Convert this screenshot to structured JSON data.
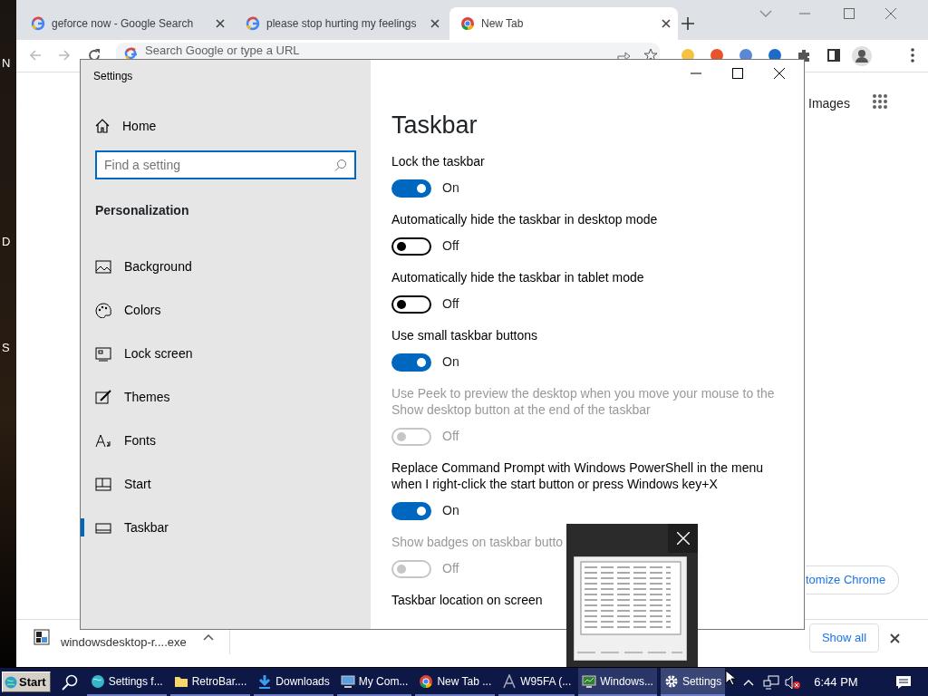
{
  "desktop": {
    "icon_labels": [
      "N",
      "D",
      "S"
    ]
  },
  "browser": {
    "tabs": [
      {
        "title": "geforce now - Google Search",
        "selected": false
      },
      {
        "title": "please stop hurting my feelings",
        "selected": false
      },
      {
        "title": "New Tab",
        "selected": true
      }
    ],
    "omnibox": {
      "placeholder": "Search Google or type a URL"
    },
    "content": {
      "images_link": "Images",
      "customize_button": "tomize Chrome"
    },
    "download_bar": {
      "file": "windowsdesktop-r....exe",
      "show_all": "Show all"
    }
  },
  "settings": {
    "title": "Settings",
    "home": "Home",
    "search": {
      "placeholder": "Find a setting"
    },
    "section": "Personalization",
    "nav": [
      {
        "label": "Background",
        "selected": false
      },
      {
        "label": "Colors",
        "selected": false
      },
      {
        "label": "Lock screen",
        "selected": false
      },
      {
        "label": "Themes",
        "selected": false
      },
      {
        "label": "Fonts",
        "selected": false
      },
      {
        "label": "Start",
        "selected": false
      },
      {
        "label": "Taskbar",
        "selected": true
      }
    ],
    "heading": "Taskbar",
    "options": [
      {
        "label": "Lock the taskbar",
        "on": true,
        "disabled": false,
        "state_text": "On"
      },
      {
        "label": "Automatically hide the taskbar in desktop mode",
        "on": false,
        "disabled": false,
        "state_text": "Off"
      },
      {
        "label": "Automatically hide the taskbar in tablet mode",
        "on": false,
        "disabled": false,
        "state_text": "Off"
      },
      {
        "label": "Use small taskbar buttons",
        "on": true,
        "disabled": false,
        "state_text": "On"
      },
      {
        "label": "Use Peek to preview the desktop when you move your mouse to the Show desktop button at the end of the taskbar",
        "on": false,
        "disabled": true,
        "state_text": "Off"
      },
      {
        "label": "Replace Command Prompt with Windows PowerShell in the menu when I right-click the start button or press Windows key+X",
        "on": true,
        "disabled": false,
        "state_text": "On"
      },
      {
        "label": "Show badges on taskbar butto",
        "on": false,
        "disabled": true,
        "state_text": "Off"
      }
    ],
    "location_label": "Taskbar location on screen"
  },
  "taskbar": {
    "start": "Start",
    "buttons": [
      {
        "label": "Settings f...",
        "selected": false,
        "hovered": false
      },
      {
        "label": "RetroBar....",
        "selected": false,
        "hovered": false
      },
      {
        "label": "Downloads",
        "selected": false,
        "hovered": false
      },
      {
        "label": "My Com...",
        "selected": false,
        "hovered": false
      },
      {
        "label": "New Tab ...",
        "selected": false,
        "hovered": false
      },
      {
        "label": "W95FA (...",
        "selected": false,
        "hovered": false
      },
      {
        "label": "Windows...",
        "selected": false,
        "hovered": true
      },
      {
        "label": "Settings",
        "selected": true,
        "hovered": false
      }
    ],
    "clock": "6:44 PM"
  }
}
